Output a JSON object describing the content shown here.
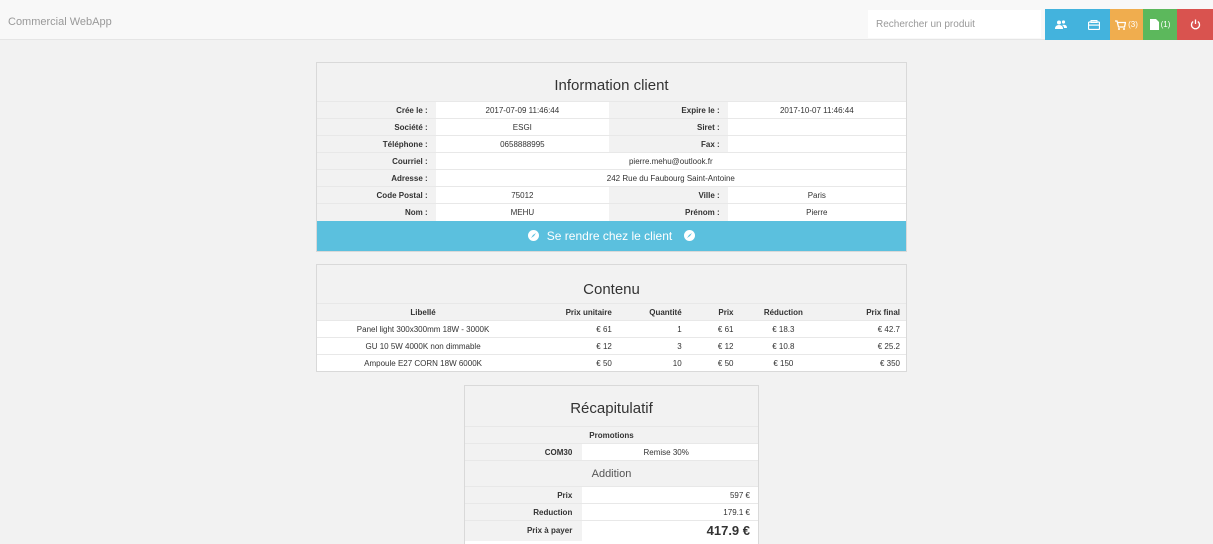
{
  "app": {
    "title": "Commercial WebApp"
  },
  "search": {
    "placeholder": "Rechercher un produit"
  },
  "nav": {
    "cart_count": "(3)",
    "docs_count": "(1)",
    "colors": {
      "info": "#43b3dd",
      "warning": "#f0ad4e",
      "success": "#5cb85c",
      "danger": "#d9534f"
    },
    "icons": [
      "users-icon",
      "store-icon",
      "cart-icon",
      "file-icon",
      "power-icon"
    ]
  },
  "info": {
    "title": "Information client",
    "rows": [
      {
        "l1": "Crée le :",
        "v1": "2017-07-09 11:46:44",
        "l2": "Expire le :",
        "v2": "2017-10-07 11:46:44"
      },
      {
        "l1": "Société :",
        "v1": "ESGI",
        "l2": "Siret :",
        "v2": ""
      },
      {
        "l1": "Téléphone :",
        "v1": "0658888995",
        "l2": "Fax :",
        "v2": ""
      }
    ],
    "courriel_label": "Courriel :",
    "courriel": "pierre.mehu@outlook.fr",
    "adresse_label": "Adresse :",
    "adresse": "242 Rue du Faubourg Saint-Antoine",
    "rows2": [
      {
        "l1": "Code Postal :",
        "v1": "75012",
        "l2": "Ville :",
        "v2": "Paris"
      },
      {
        "l1": "Nom :",
        "v1": "MEHU",
        "l2": "Prénom :",
        "v2": "Pierre"
      }
    ],
    "button": "Se rendre chez le client"
  },
  "contenu": {
    "title": "Contenu",
    "headers": [
      "Libellé",
      "Prix unitaire",
      "Quantité",
      "Prix",
      "Réduction",
      "Prix final"
    ],
    "rows": [
      [
        "Panel light 300x300mm 18W - 3000K",
        "€ 61",
        "1",
        "€ 61",
        "€ 18.3",
        "€ 42.7"
      ],
      [
        "GU 10 5W 4000K non dimmable",
        "€ 12",
        "3",
        "€ 12",
        "€ 10.8",
        "€ 25.2"
      ],
      [
        "Ampoule E27 CORN 18W 6000K",
        "€ 50",
        "10",
        "€ 50",
        "€ 150",
        "€ 350"
      ]
    ]
  },
  "recap": {
    "title": "Récapitulatif",
    "promotions_label": "Promotions",
    "promo_code": "COM30",
    "promo_desc": "Remise 30%",
    "addition_label": "Addition",
    "prix_label": "Prix",
    "prix": "597 €",
    "reduction_label": "Reduction",
    "reduction": "179.1 €",
    "apayer_label": "Prix à payer",
    "apayer": "417.9 €"
  }
}
